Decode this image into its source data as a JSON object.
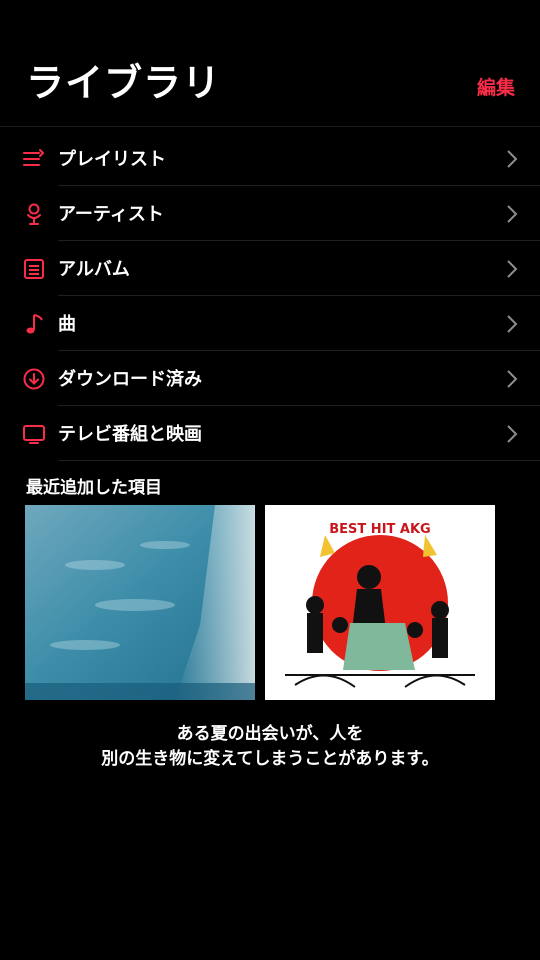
{
  "header": {
    "title": "ライブラリ",
    "edit_label": "編集"
  },
  "menu": {
    "items": [
      {
        "label": "プレイリスト",
        "icon": "playlist-icon"
      },
      {
        "label": "アーティスト",
        "icon": "microphone-icon"
      },
      {
        "label": "アルバム",
        "icon": "album-icon"
      },
      {
        "label": "曲",
        "icon": "music-note-icon"
      },
      {
        "label": "ダウンロード済み",
        "icon": "download-icon"
      },
      {
        "label": "テレビ番組と映画",
        "icon": "tv-icon"
      }
    ]
  },
  "recent": {
    "title": "最近追加した項目",
    "albums": [
      {
        "cover_art_text": ""
      },
      {
        "cover_art_text": "BEST HIT AKG"
      }
    ],
    "caption_line1": "ある夏の出会いが、人を",
    "caption_line2": "別の生き物に変えてしまうことがあります。"
  },
  "colors": {
    "accent": "#fa2d48",
    "background": "#000000",
    "separator": "#1f1f21"
  }
}
